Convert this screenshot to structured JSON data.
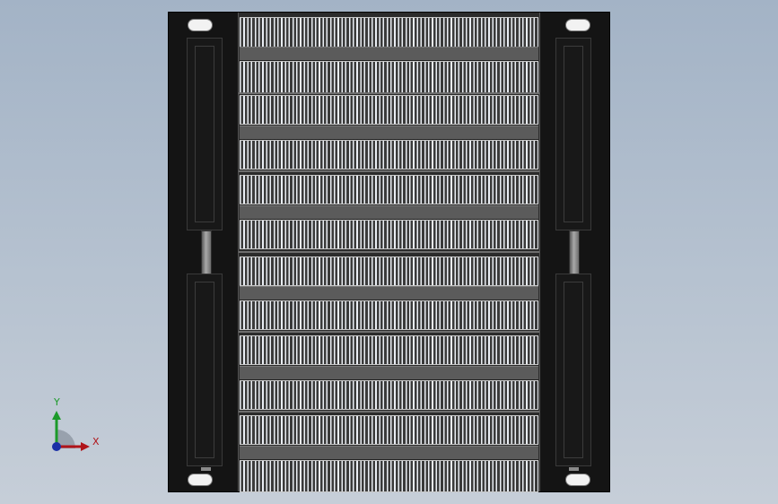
{
  "view": {
    "triad": {
      "x_label": "X",
      "y_label": "Y",
      "x_color": "#b0141a",
      "y_color": "#1c9a2a",
      "z_color": "#1a2fa6"
    },
    "background_top": "#a3b3c6",
    "background_bottom": "#c6ced8"
  },
  "model": {
    "fin_block_count": 12,
    "body_color": "#141414",
    "fin_color": "#e9edf3"
  }
}
